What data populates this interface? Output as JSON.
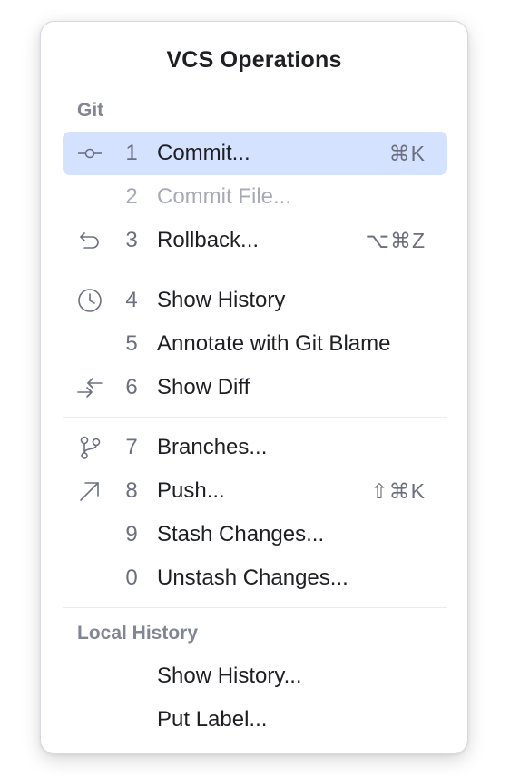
{
  "popup": {
    "title": "VCS Operations"
  },
  "sections": {
    "git": "Git",
    "local_history": "Local History"
  },
  "items": [
    {
      "num": "1",
      "label": "Commit...",
      "shortcut": "⌘K",
      "icon": "commit-icon",
      "selected": true,
      "disabled": false
    },
    {
      "num": "2",
      "label": "Commit File...",
      "shortcut": "",
      "icon": "",
      "selected": false,
      "disabled": true
    },
    {
      "num": "3",
      "label": "Rollback...",
      "shortcut": "⌥⌘Z",
      "icon": "rollback-icon",
      "selected": false,
      "disabled": false
    },
    {
      "num": "4",
      "label": "Show History",
      "shortcut": "",
      "icon": "history-clock-icon",
      "selected": false,
      "disabled": false
    },
    {
      "num": "5",
      "label": "Annotate with Git Blame",
      "shortcut": "",
      "icon": "",
      "selected": false,
      "disabled": false
    },
    {
      "num": "6",
      "label": "Show Diff",
      "shortcut": "",
      "icon": "diff-arrows-icon",
      "selected": false,
      "disabled": false
    },
    {
      "num": "7",
      "label": "Branches...",
      "shortcut": "",
      "icon": "branch-icon",
      "selected": false,
      "disabled": false
    },
    {
      "num": "8",
      "label": "Push...",
      "shortcut": "⇧⌘K",
      "icon": "push-arrow-icon",
      "selected": false,
      "disabled": false
    },
    {
      "num": "9",
      "label": "Stash Changes...",
      "shortcut": "",
      "icon": "",
      "selected": false,
      "disabled": false
    },
    {
      "num": "0",
      "label": "Unstash Changes...",
      "shortcut": "",
      "icon": "",
      "selected": false,
      "disabled": false
    }
  ],
  "local_history_items": [
    {
      "label": "Show History..."
    },
    {
      "label": "Put Label..."
    }
  ]
}
